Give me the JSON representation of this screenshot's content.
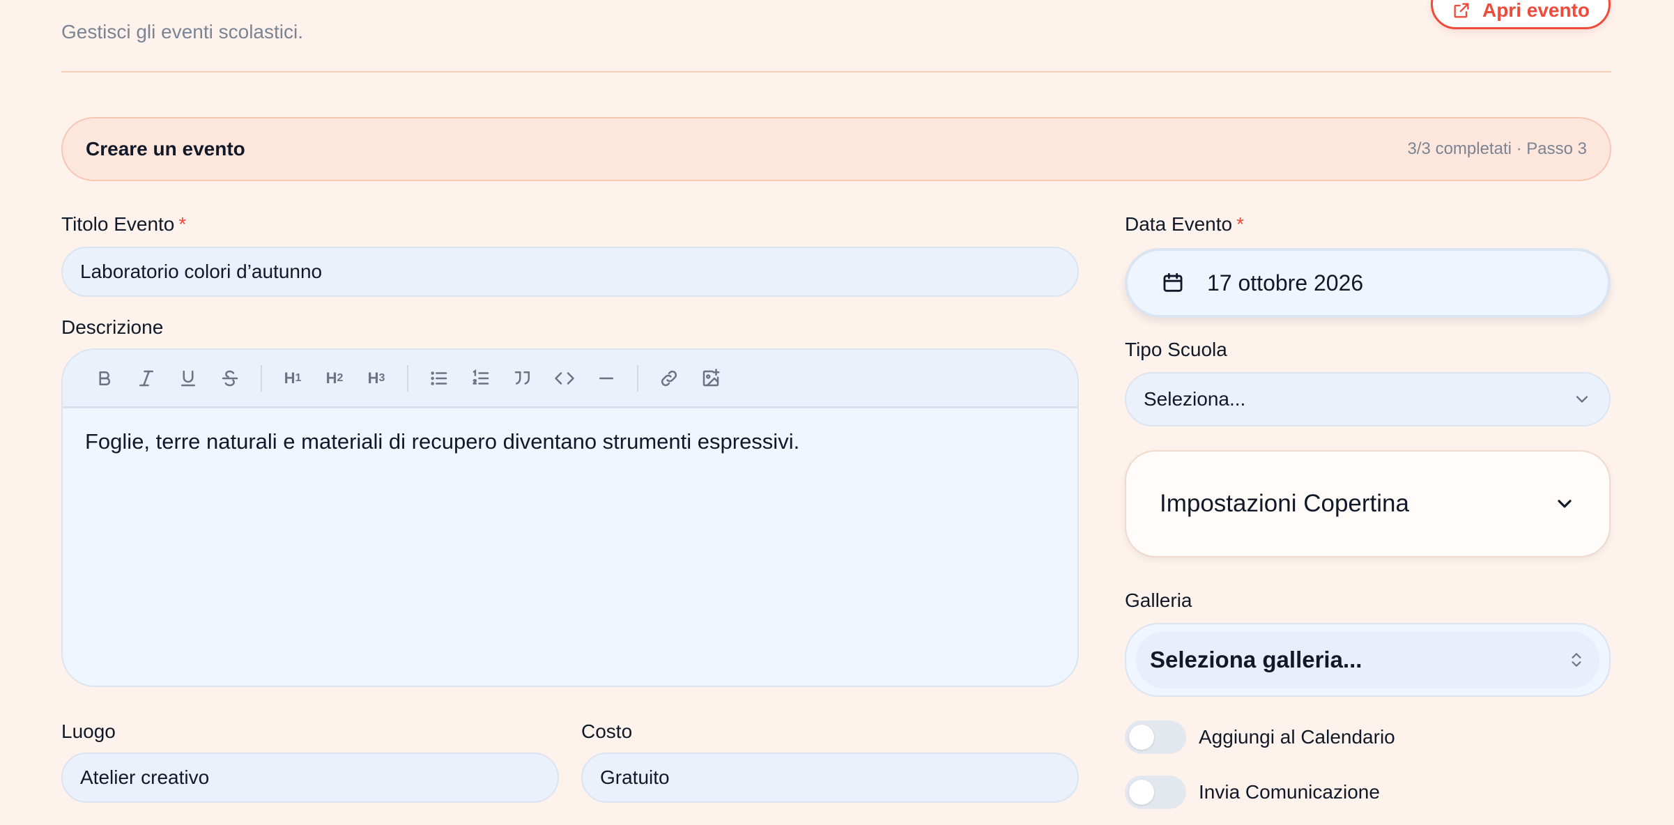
{
  "header": {
    "subtitle": "Gestisci gli eventi scolastici.",
    "open_button_label": "Apri evento"
  },
  "step": {
    "title": "Creare un evento",
    "status": "3/3 completati · Passo 3"
  },
  "form": {
    "title_label": "Titolo Evento",
    "title_value": "Laboratorio colori d’autunno",
    "required_mark": "*",
    "description_label": "Descrizione",
    "description_text": "Foglie, terre naturali e materiali di recupero diventano strumenti espressivi.",
    "toolbar": {
      "h1": "H",
      "h1_sub": "1",
      "h2": "H",
      "h2_sub": "2",
      "h3": "H",
      "h3_sub": "3"
    },
    "location_label": "Luogo",
    "location_value": "Atelier creativo",
    "cost_label": "Costo",
    "cost_value": "Gratuito",
    "date_label": "Data Evento",
    "date_value": "17 ottobre 2026",
    "school_type_label": "Tipo Scuola",
    "school_type_value": "Seleziona...",
    "cover_settings_label": "Impostazioni Copertina",
    "gallery_label": "Galleria",
    "gallery_value": "Seleziona galleria...",
    "toggle_calendar_label": "Aggiungi al Calendario",
    "toggle_calendar_on": false,
    "toggle_notify_label": "Invia Comunicazione",
    "toggle_notify_on": false
  },
  "colors": {
    "background": "#fdf2ec",
    "accent": "#ef4a3a",
    "input_bg": "#ebf1fb"
  }
}
